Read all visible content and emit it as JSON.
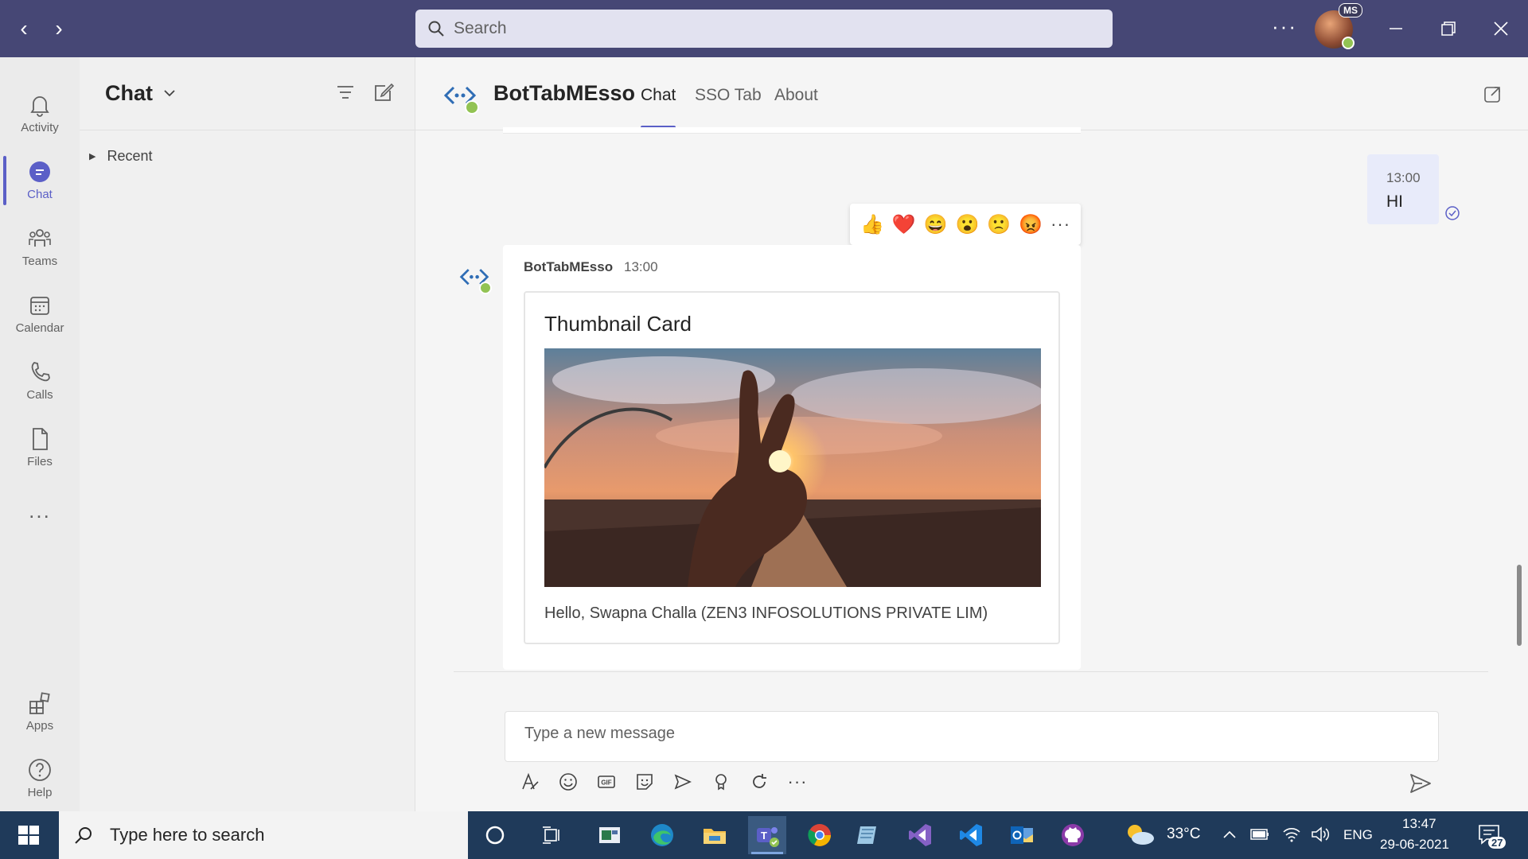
{
  "titlebar": {
    "search_placeholder": "Search",
    "avatar_initials": "MS"
  },
  "rail": {
    "items": [
      {
        "label": "Activity"
      },
      {
        "label": "Chat"
      },
      {
        "label": "Teams"
      },
      {
        "label": "Calendar"
      },
      {
        "label": "Calls"
      },
      {
        "label": "Files"
      },
      {
        "label": "Apps"
      },
      {
        "label": "Help"
      }
    ],
    "more": "..."
  },
  "chatlist": {
    "title": "Chat",
    "recent_label": "Recent"
  },
  "conversation": {
    "bot_name": "BotTabMEsso",
    "tabs": [
      {
        "label": "Chat"
      },
      {
        "label": "SSO Tab"
      },
      {
        "label": "About"
      }
    ],
    "sent_message": {
      "time": "13:00",
      "text": "HI"
    },
    "reactions": [
      "👍",
      "❤️",
      "😄",
      "😮",
      "🙁",
      "😡"
    ],
    "bot_message": {
      "sender": "BotTabMEsso",
      "time": "13:00",
      "card_title": "Thumbnail Card",
      "card_text": "Hello, Swapna Challa (ZEN3 INFOSOLUTIONS PRIVATE LIM)"
    },
    "compose_placeholder": "Type a new message"
  },
  "taskbar": {
    "search_placeholder": "Type here to search",
    "weather": "33°C",
    "language": "ENG",
    "time": "13:47",
    "date": "29-06-2021",
    "notifications": "27"
  },
  "colors": {
    "titlebar": "#464775",
    "accent": "#5b5fc7",
    "presence": "#92c353",
    "taskbar": "#1f3a5a"
  }
}
